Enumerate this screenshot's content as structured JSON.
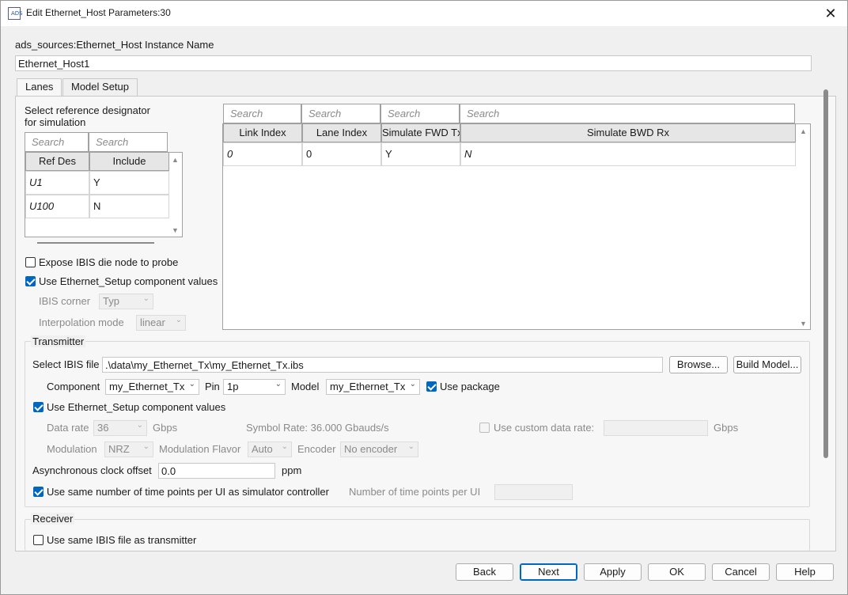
{
  "window": {
    "title": "Edit Ethernet_Host Parameters:30",
    "icon_text": "ADS"
  },
  "instance": {
    "label": "ads_sources:Ethernet_Host Instance Name",
    "value": "Ethernet_Host1"
  },
  "tabs": [
    {
      "label": "Lanes",
      "active": true
    },
    {
      "label": "Model Setup",
      "active": false
    }
  ],
  "refdes": {
    "label_line1": "Select reference designator",
    "label_line2": "for simulation",
    "search_placeholder": "Search",
    "headers": [
      "Ref Des",
      "Include"
    ],
    "rows": [
      {
        "ref": "U1",
        "include": "Y"
      },
      {
        "ref": "U100",
        "include": "N"
      }
    ]
  },
  "lanes_grid": {
    "search_placeholder": "Search",
    "headers": [
      "Link Index",
      "Lane Index",
      "Simulate FWD Tx",
      "Simulate BWD Rx"
    ],
    "rows": [
      {
        "link": "0",
        "lane": "0",
        "fwd": "Y",
        "bwd": "N"
      }
    ]
  },
  "options": {
    "expose_ibis": {
      "label": "Expose IBIS die node to probe",
      "checked": false
    },
    "use_setup": {
      "label": "Use Ethernet_Setup component values",
      "checked": true
    },
    "ibis_corner": {
      "label": "IBIS corner",
      "value": "Typ"
    },
    "interp_mode": {
      "label": "Interpolation mode",
      "value": "linear"
    }
  },
  "transmitter": {
    "title": "Transmitter",
    "ibis_label": "Select IBIS file",
    "ibis_value": ".\\data\\my_Ethernet_Tx\\my_Ethernet_Tx.ibs",
    "browse": "Browse...",
    "build_model": "Build Model...",
    "component_label": "Component",
    "component_value": "my_Ethernet_Tx",
    "pin_label": "Pin",
    "pin_value": "1p",
    "model_label": "Model",
    "model_value": "my_Ethernet_Tx",
    "use_package": {
      "label": "Use package",
      "checked": true
    },
    "use_setup": {
      "label": "Use Ethernet_Setup component values",
      "checked": true
    },
    "data_rate_label": "Data rate",
    "data_rate_value": "36",
    "data_rate_unit": "Gbps",
    "symbol_rate": "Symbol Rate: 36.000 Gbauds/s",
    "custom_rate": {
      "label": "Use custom data rate:",
      "checked": false,
      "unit": "Gbps"
    },
    "modulation_label": "Modulation",
    "modulation_value": "NRZ",
    "flavor_label": "Modulation Flavor",
    "flavor_value": "Auto",
    "encoder_label": "Encoder",
    "encoder_value": "No encoder",
    "async_label": "Asynchronous clock offset",
    "async_value": "0.0",
    "async_unit": "ppm",
    "same_points": {
      "label": "Use same number of time points per UI as simulator controller",
      "checked": true
    },
    "points_label": "Number of time points per UI"
  },
  "receiver": {
    "title": "Receiver",
    "same_ibis": {
      "label": "Use same IBIS file as transmitter",
      "checked": false
    }
  },
  "buttons": {
    "back": "Back",
    "next": "Next",
    "apply": "Apply",
    "ok": "OK",
    "cancel": "Cancel",
    "help": "Help"
  },
  "icons": {
    "close": "close-icon",
    "dropdown": "chevron-down-icon"
  }
}
